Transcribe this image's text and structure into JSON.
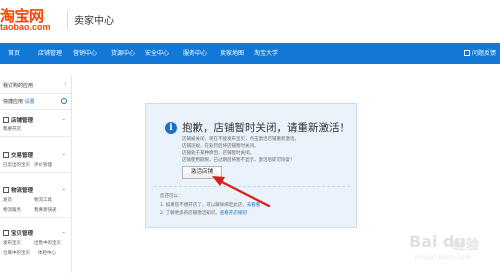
{
  "header": {
    "logo_text": "淘宝网",
    "logo_url": "taobao.com",
    "seller_center": "卖家中心"
  },
  "nav": {
    "items": [
      "首页",
      "店铺管理",
      "营销中心",
      "货源中心",
      "安全中心",
      "服务中心",
      "卖家地图",
      "淘宝大学"
    ],
    "right": "问题反馈"
  },
  "sidebar": {
    "subscribed_apps": "我订购的应用",
    "quick_apps": "快捷应用",
    "quick_apps_setting": "设置",
    "sections": [
      {
        "title": "店铺管理",
        "links": [
          "我要开店"
        ]
      },
      {
        "title": "交易管理",
        "links": [
          "已卖出的宝贝",
          "评价管理"
        ]
      },
      {
        "title": "物流管理",
        "links": [
          "发货",
          "物流工具",
          "物流服务",
          "我要寄快递"
        ]
      },
      {
        "title": "宝贝管理",
        "links": [
          "发布宝贝",
          "出售中的宝贝",
          "仓库中的宝贝",
          "体检中心"
        ]
      }
    ]
  },
  "notice": {
    "title": "抱歉，店铺暂时关闭，请重新激活！",
    "lines": [
      "店铺被关闭，现在不能发布宝贝，点击激活店铺重新激活。",
      "店铺违规，在处罚后将店铺暂时关闭。",
      "店铺处于某种原因，店铺暂时关闭。",
      "店铺使用期限，已过期后将暂不显示，激活后即可恢复！"
    ],
    "activate_button": "激活店铺",
    "tips_title": "您还可以：",
    "tips": [
      {
        "text": "1. 如果您不想开店了，可以解除绑定此店，",
        "link": "去看看"
      },
      {
        "text": "2. 了解更多的店铺激活知识。",
        "link": "查看开店规则"
      }
    ]
  },
  "watermark": {
    "brand": "Bai du",
    "suffix": "经验",
    "url": "jingyan.baidu.com"
  },
  "colors": {
    "nav_bg": "#1178d6",
    "brand_orange": "#ff4400",
    "notice_bg": "#eaf3fb",
    "arrow_red": "#d91e1e"
  }
}
